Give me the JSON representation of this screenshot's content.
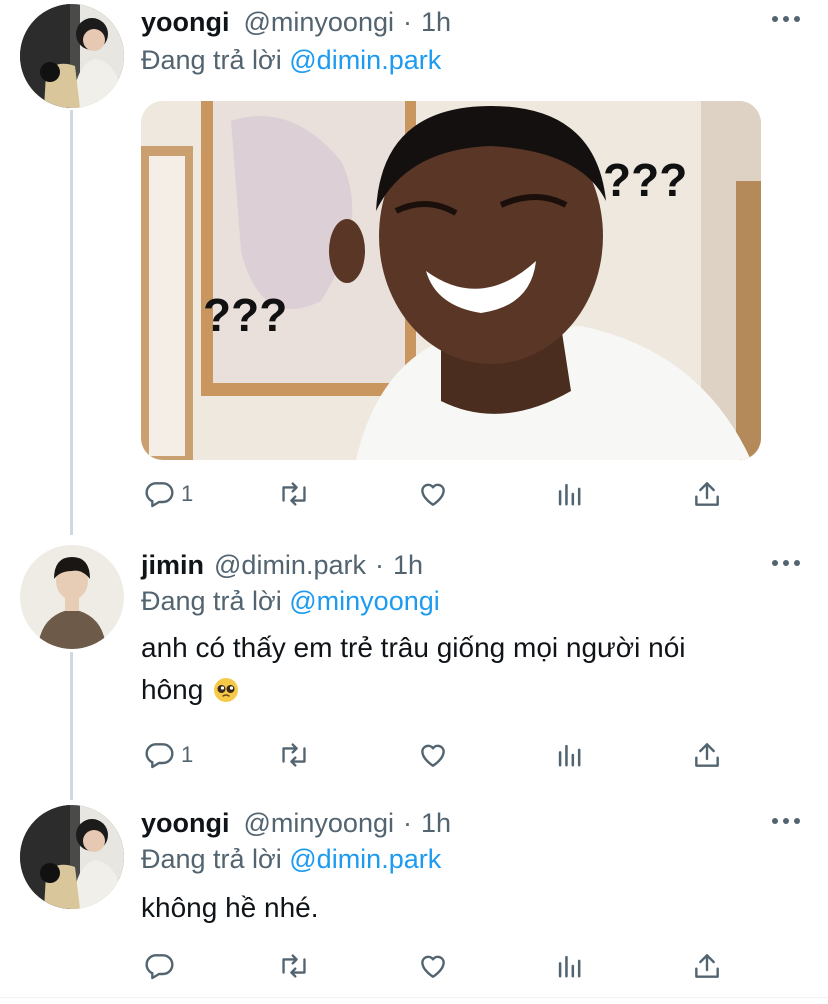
{
  "tweets": [
    {
      "name": "yoongi",
      "handle": "@minyoongi",
      "separator": "·",
      "time": "1h",
      "replying_prefix": "Đang trả lời ",
      "replying_to": "@dimin.park",
      "text": "",
      "media": {
        "marks": [
          "???",
          "???"
        ]
      },
      "reply_count": "1",
      "avatar_icon": "profile-photo"
    },
    {
      "name": "jimin",
      "handle": "@dimin.park",
      "separator": "·",
      "time": "1h",
      "replying_prefix": "Đang trả lời ",
      "replying_to": "@minyoongi",
      "text_line1": "anh có thấy em trẻ trâu giống mọi người nói",
      "text_line2": "hông",
      "text_emoji": "pleading-face-emoji",
      "reply_count": "1",
      "avatar_icon": "profile-photo"
    },
    {
      "name": "yoongi",
      "handle": "@minyoongi",
      "separator": "·",
      "time": "1h",
      "replying_prefix": "Đang trả lời ",
      "replying_to": "@dimin.park",
      "text": "không hề nhé.",
      "reply_count": "",
      "avatar_icon": "profile-photo"
    }
  ],
  "icons": {
    "reply": "reply-icon",
    "retweet": "retweet-icon",
    "like": "like-icon",
    "views": "views-icon",
    "share": "share-icon",
    "more": "more-icon"
  },
  "colors": {
    "text": "#0f1419",
    "secondary": "#536471",
    "accent": "#1d9bf0",
    "thread_line": "#cfd9de"
  }
}
